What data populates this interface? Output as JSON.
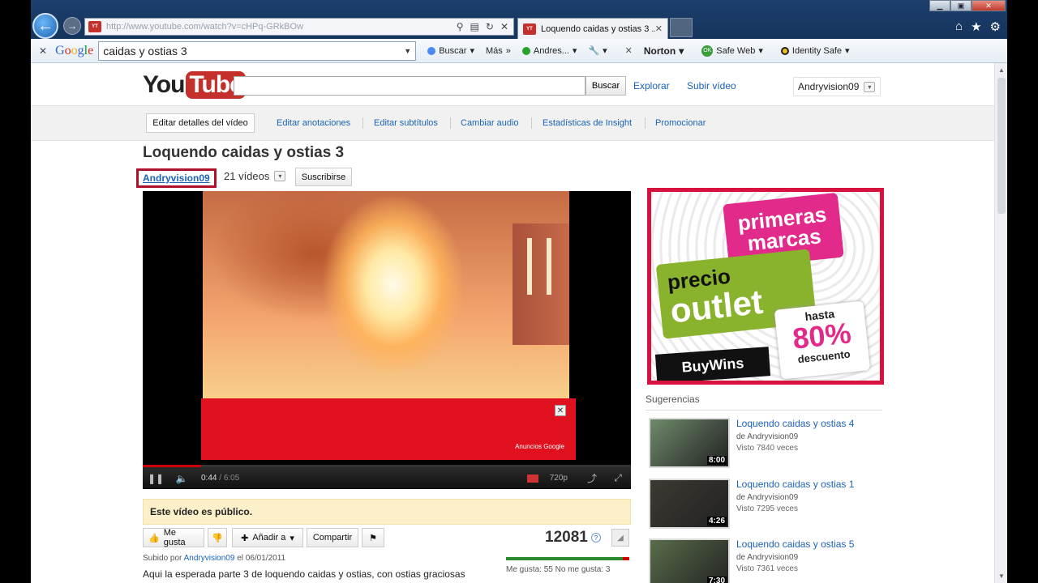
{
  "browser": {
    "address_url": "http://www.youtube.com/watch?v=cHPq-GRkBOw",
    "tab_title": "Loquendo caidas y ostias 3 ...",
    "favicon_text": "You Tube"
  },
  "google_toolbar": {
    "logo": "Google",
    "search_value": "caidas y ostias 3",
    "search_label": "Buscar",
    "more_label": "Más",
    "user_label": "Andres...",
    "norton_label": "Norton",
    "safe_web_label": "Safe Web",
    "identity_safe_label": "Identity Safe"
  },
  "header": {
    "logo_you": "You",
    "logo_tube": "Tube",
    "search_value": "",
    "search_button": "Buscar",
    "explore": "Explorar",
    "upload": "Subir vídeo",
    "username": "Andryvision09"
  },
  "owner_bar": {
    "edit_details": "Editar detalles del vídeo",
    "links": [
      "Editar anotaciones",
      "Editar subtítulos",
      "Cambiar audio",
      "Estadísticas de Insight",
      "Promocionar"
    ]
  },
  "video": {
    "title": "Loquendo caidas y ostias 3",
    "channel": "Andryvision09",
    "video_count": "21 vídeos",
    "subscribe": "Suscribirse",
    "current_time": "0:44",
    "total_time": "6:05",
    "progress_fraction": 0.12,
    "quality": "720p",
    "ad_label": "Anuncios Google"
  },
  "info": {
    "public_notice": "Este vídeo es público.",
    "like": "Me gusta",
    "add_to": "Añadir a",
    "share": "Compartir",
    "views": "12081",
    "uploaded_prefix": "Subido por",
    "uploader": "Andryvision09",
    "uploaded_date": "el 06/01/2011",
    "likes_text": "Me gusta: 55 No me gusta: 3",
    "likes": 55,
    "dislikes": 3,
    "description": "Aqui la esperada parte 3 de loquendo caidas y ostias, con ostias graciosas"
  },
  "banner": {
    "line1": "primeras marcas",
    "line2a": "precio",
    "line2b": "outlet",
    "hasta": "hasta",
    "percent": "80%",
    "descuento": "descuento",
    "brand": "BuyWins"
  },
  "suggestions": {
    "heading": "Sugerencias",
    "items": [
      {
        "title": "Loquendo caidas y ostias 4",
        "by": "de Andryvision09",
        "views": "Visto 7840 veces",
        "duration": "8:00",
        "color": "#6e8a6a"
      },
      {
        "title": "Loquendo caidas y ostias 1",
        "by": "de Andryvision09",
        "views": "Visto 7295 veces",
        "duration": "4:26",
        "color": "#3d3a32"
      },
      {
        "title": "Loquendo caidas y ostias 5",
        "by": "de Andryvision09",
        "views": "Visto 7361 veces",
        "duration": "7:30",
        "color": "#5a6d4a"
      }
    ]
  }
}
